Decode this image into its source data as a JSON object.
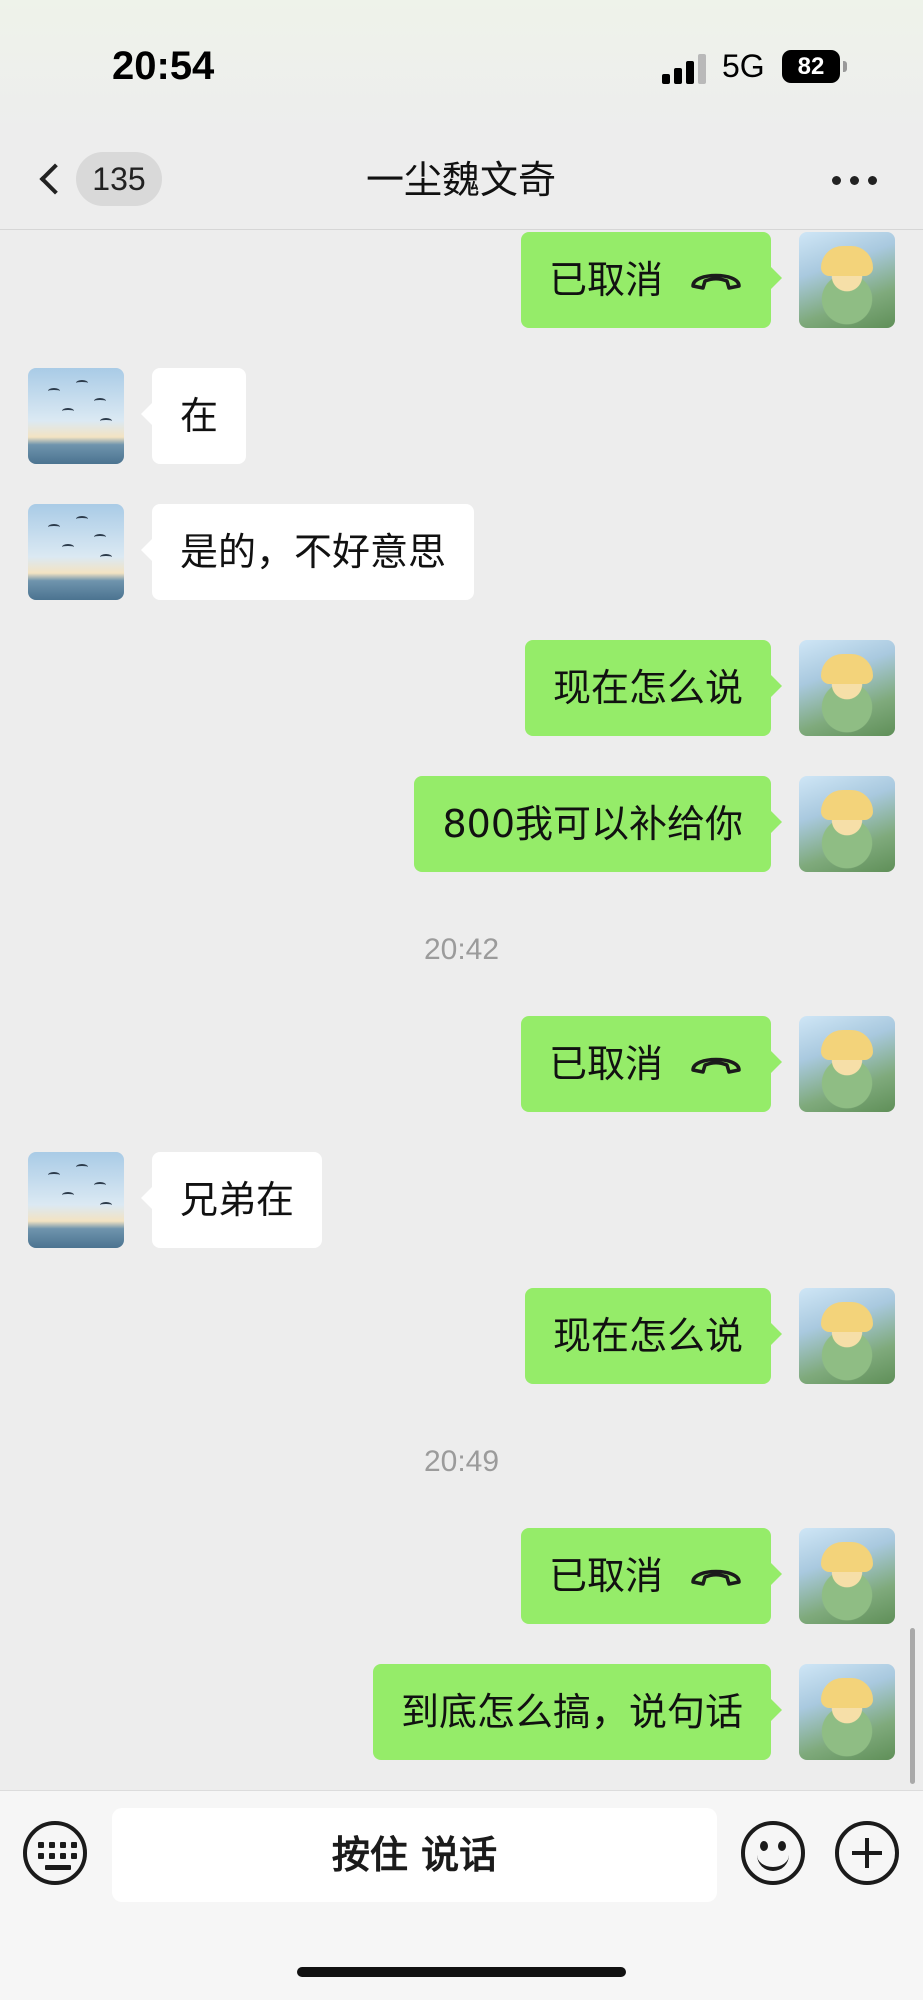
{
  "status_bar": {
    "time": "20:54",
    "network": "5G",
    "battery": "82"
  },
  "nav": {
    "unread_count": "135",
    "title": "一尘魏文奇"
  },
  "messages": [
    {
      "from": "me",
      "text": "已取消",
      "icon": "call-declined-icon"
    },
    {
      "from": "other",
      "text": "在"
    },
    {
      "from": "other",
      "text": "是的，不好意思"
    },
    {
      "from": "me",
      "text": "现在怎么说"
    },
    {
      "from": "me",
      "text": "800我可以补给你"
    },
    {
      "time": "20:42"
    },
    {
      "from": "me",
      "text": "已取消",
      "icon": "call-declined-icon"
    },
    {
      "from": "other",
      "text": "兄弟在"
    },
    {
      "from": "me",
      "text": "现在怎么说"
    },
    {
      "time": "20:49"
    },
    {
      "from": "me",
      "text": "已取消",
      "icon": "call-declined-icon"
    },
    {
      "from": "me",
      "text": "到底怎么搞，说句话"
    }
  ],
  "input_bar": {
    "hold_to_talk": "按住 说话"
  },
  "colors": {
    "my_bubble": "#95ec69",
    "other_bubble": "#ffffff",
    "background": "#ededed"
  }
}
